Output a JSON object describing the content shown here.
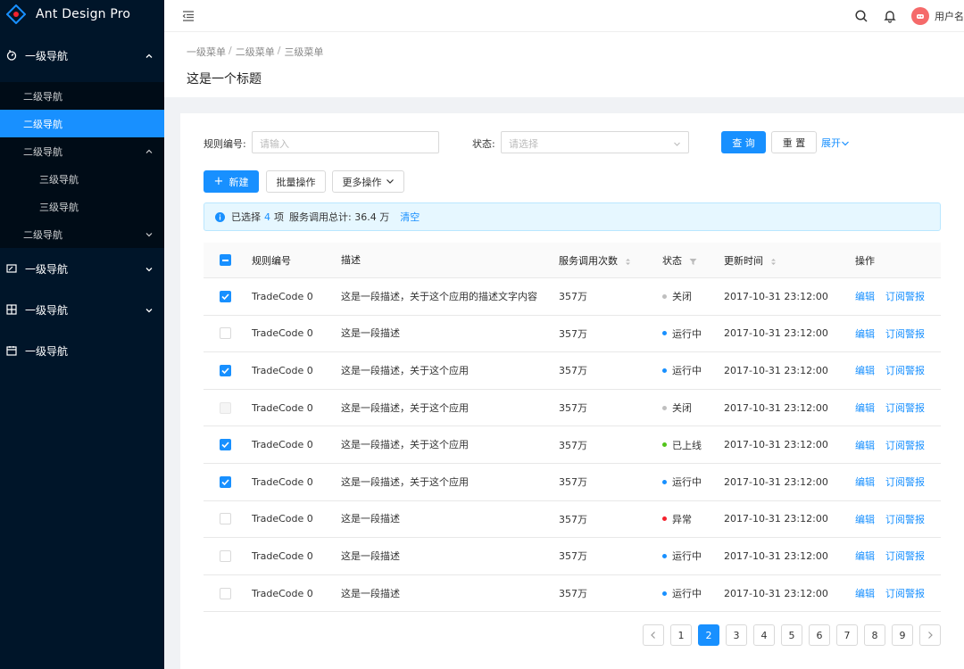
{
  "app": {
    "title": "Ant Design Pro"
  },
  "sidebar": {
    "groups": [
      {
        "label": "一级导航",
        "icon": "dashboard-icon",
        "expanded": true,
        "children": [
          {
            "label": "二级导航"
          },
          {
            "label": "二级导航",
            "active": true
          },
          {
            "label": "二级导航",
            "expanded": true,
            "children": [
              {
                "label": "三级导航"
              },
              {
                "label": "三级导航"
              }
            ]
          },
          {
            "label": "二级导航"
          }
        ]
      },
      {
        "label": "一级导航",
        "icon": "form-icon"
      },
      {
        "label": "一级导航",
        "icon": "table-icon"
      },
      {
        "label": "一级导航",
        "icon": "calendar-icon"
      }
    ]
  },
  "header": {
    "username": "用户名"
  },
  "breadcrumb": [
    "一级菜单",
    "二级菜单",
    "三级菜单"
  ],
  "page_title": "这是一个标题",
  "filters": {
    "rule_label": "规则编号:",
    "rule_placeholder": "请输入",
    "status_label": "状态:",
    "status_placeholder": "请选择",
    "query": "查 询",
    "reset": "重 置",
    "expand": "展开"
  },
  "toolbar": {
    "new": "新建",
    "batch": "批量操作",
    "more": "更多操作"
  },
  "alert": {
    "prefix": "已选择",
    "count": "4",
    "unit": "项",
    "summary": "服务调用总计: 36.4 万",
    "clear": "清空"
  },
  "table": {
    "columns": [
      "规则编号",
      "描述",
      "服务调用次数",
      "状态",
      "更新时间",
      "操作"
    ],
    "rows": [
      {
        "checked": true,
        "code": "TradeCode 0",
        "desc": "这是一段描述，关于这个应用的描述文字内容",
        "count": "357万",
        "status": "关闭",
        "status_color": "#bfbfbf",
        "time": "2017-10-31  23:12:00",
        "op1": "编辑",
        "op2": "订阅警报"
      },
      {
        "checked": false,
        "code": "TradeCode 0",
        "desc": "这是一段描述",
        "count": "357万",
        "status": "运行中",
        "status_color": "#1890ff",
        "time": "2017-10-31  23:12:00",
        "op1": "编辑",
        "op2": "订阅警报"
      },
      {
        "checked": true,
        "code": "TradeCode 0",
        "desc": "这是一段描述，关于这个应用",
        "count": "357万",
        "status": "运行中",
        "status_color": "#1890ff",
        "time": "2017-10-31  23:12:00",
        "op1": "编辑",
        "op2": "订阅警报"
      },
      {
        "checked": false,
        "disabled": true,
        "code": "TradeCode 0",
        "desc": "这是一段描述，关于这个应用",
        "count": "357万",
        "status": "关闭",
        "status_color": "#bfbfbf",
        "time": "2017-10-31  23:12:00",
        "op1": "编辑",
        "op2": "订阅警报"
      },
      {
        "checked": true,
        "code": "TradeCode 0",
        "desc": "这是一段描述，关于这个应用",
        "count": "357万",
        "status": "已上线",
        "status_color": "#52c41a",
        "time": "2017-10-31  23:12:00",
        "op1": "编辑",
        "op2": "订阅警报"
      },
      {
        "checked": true,
        "code": "TradeCode 0",
        "desc": "这是一段描述，关于这个应用",
        "count": "357万",
        "status": "运行中",
        "status_color": "#1890ff",
        "time": "2017-10-31  23:12:00",
        "op1": "编辑",
        "op2": "订阅警报"
      },
      {
        "checked": false,
        "code": "TradeCode 0",
        "desc": "这是一段描述",
        "count": "357万",
        "status": "异常",
        "status_color": "#f5222d",
        "time": "2017-10-31  23:12:00",
        "op1": "编辑",
        "op2": "订阅警报"
      },
      {
        "checked": false,
        "code": "TradeCode 0",
        "desc": "这是一段描述",
        "count": "357万",
        "status": "运行中",
        "status_color": "#1890ff",
        "time": "2017-10-31  23:12:00",
        "op1": "编辑",
        "op2": "订阅警报"
      },
      {
        "checked": false,
        "code": "TradeCode 0",
        "desc": "这是一段描述",
        "count": "357万",
        "status": "运行中",
        "status_color": "#1890ff",
        "time": "2017-10-31  23:12:00",
        "op1": "编辑",
        "op2": "订阅警报"
      }
    ]
  },
  "pagination": {
    "pages": [
      "1",
      "2",
      "3",
      "4",
      "5",
      "6",
      "7",
      "8",
      "9"
    ],
    "current": "2"
  },
  "colors": {
    "primary": "#1890ff",
    "sidebar": "#001529",
    "submenu": "#000c17"
  }
}
